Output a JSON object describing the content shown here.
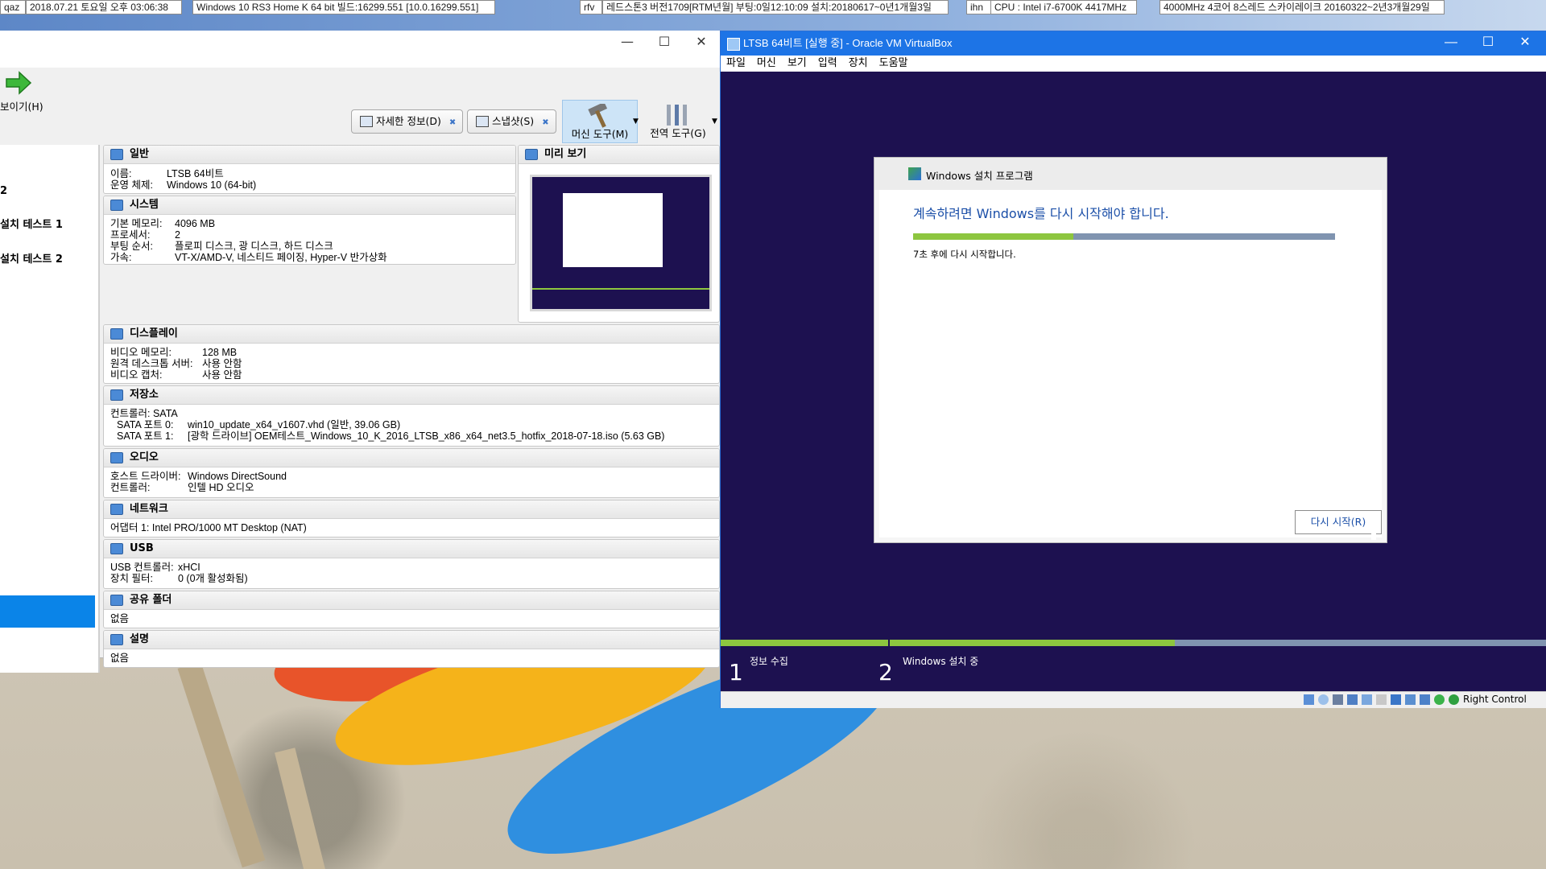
{
  "top_bar": {
    "items": [
      "qaz",
      "2018.07.21 토요일 오후 03:06:38",
      "Windows 10 RS3 Home K 64 bit 빌드:16299.551 [10.0.16299.551]",
      "rfv",
      "레드스톤3 버전1709[RTM년월] 부팅:0일12:10:09 설치:20180617~0년1개월3일",
      "ihn",
      "CPU : Intel i7-6700K 4417MHz",
      "4000MHz 4코어 8스레드 스카이레이크 20160322~2년3개월29일"
    ]
  },
  "manager": {
    "window_controls": [
      "—",
      "☐",
      "✕"
    ],
    "toolbar": {
      "show_label": "보이기(H)",
      "details_label": "자세한 정보(D)",
      "snapshots_label": "스냅샷(S)",
      "machine_tools_label": "머신 도구(M)",
      "global_tools_label": "전역 도구(G)"
    },
    "vm_list": {
      "items": [
        "2",
        "설치 테스트 1",
        "설치 테스트 2"
      ]
    },
    "general": {
      "title": "일반",
      "name_key": "이름:",
      "name_val": "LTSB 64비트",
      "os_key": "운영 체제:",
      "os_val": "Windows 10 (64-bit)"
    },
    "system": {
      "title": "시스템",
      "mem_key": "기본 메모리:",
      "mem_val": "4096 MB",
      "cpu_key": "프로세서:",
      "cpu_val": "2",
      "boot_key": "부팅 순서:",
      "boot_val": "플로피 디스크, 광 디스크, 하드 디스크",
      "accel_key": "가속:",
      "accel_val": "VT-X/AMD-V, 네스티드 페이징, Hyper-V 반가상화"
    },
    "preview": {
      "title": "미리 보기"
    },
    "display": {
      "title": "디스플레이",
      "vmem_key": "비디오 메모리:",
      "vmem_val": "128 MB",
      "rdp_key": "원격 데스크톱 서버:",
      "rdp_val": "사용 안함",
      "cap_key": "비디오 캡처:",
      "cap_val": "사용 안함"
    },
    "storage": {
      "title": "저장소",
      "ctrl": "컨트롤러: SATA",
      "port0_key": "SATA 포트 0:",
      "port0_val": "win10_update_x64_v1607.vhd (일반, 39.06 GB)",
      "port1_key": "SATA 포트 1:",
      "port1_val": "[광학 드라이브] OEM테스트_Windows_10_K_2016_LTSB_x86_x64_net3.5_hotfix_2018-07-18.iso (5.63 GB)"
    },
    "audio": {
      "title": "오디오",
      "host_key": "호스트 드라이버:",
      "host_val": "Windows DirectSound",
      "ctrl_key": "컨트롤러:",
      "ctrl_val": "인텔 HD 오디오"
    },
    "network": {
      "title": "네트워크",
      "adapter": "어댑터 1:   Intel PRO/1000 MT Desktop (NAT)"
    },
    "usb": {
      "title": "USB",
      "ctrl_key": "USB 컨트롤러:",
      "ctrl_val": "xHCI",
      "filter_key": "장치 필터:",
      "filter_val": "0 (0개 활성화됨)"
    },
    "shared": {
      "title": "공유 폴더",
      "value": "없음"
    },
    "description": {
      "title": "설명",
      "value": "없음"
    }
  },
  "vm": {
    "title": "LTSB 64비트 [실행 중] - Oracle VM VirtualBox",
    "window_controls": [
      "—",
      "☐",
      "✕"
    ],
    "menu": [
      "파일",
      "머신",
      "보기",
      "입력",
      "장치",
      "도움말"
    ],
    "setup": {
      "title": "Windows 설치 프로그램",
      "heading": "계속하려면 Windows를 다시 시작해야 합니다.",
      "progress": 0.38,
      "countdown": "7초 후에 다시 시작합니다.",
      "restart_button": "다시 시작(R)"
    },
    "steps": [
      {
        "num": "1",
        "label": "정보 수집"
      },
      {
        "num": "2",
        "label": "Windows 설치 중"
      }
    ],
    "bottom_progress": 0.55,
    "status": {
      "host_key": "Right Control"
    }
  },
  "colors": {
    "vm_title": "#1d74e6",
    "vm_bg": "#1d1150",
    "progress_green": "#8dc63f",
    "progress_track": "#8094b0",
    "selected_blue": "#0a84e8"
  }
}
